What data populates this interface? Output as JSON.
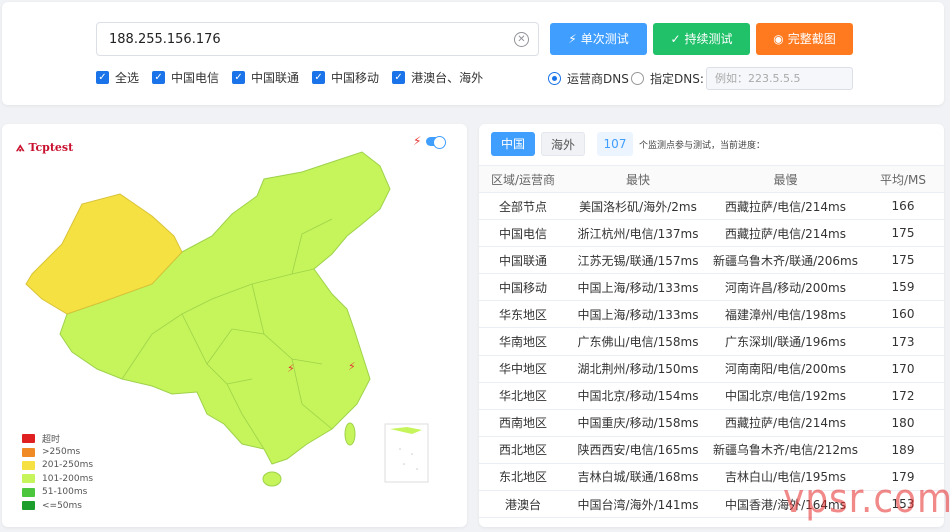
{
  "search": {
    "ip_value": "188.255.156.176",
    "clear_icon": "close-circle-icon"
  },
  "buttons": {
    "single": {
      "icon": "⚡",
      "label": "单次测试",
      "color": "#409eff"
    },
    "continuous": {
      "icon": "✓",
      "label": "持续测试",
      "color": "#21c16a"
    },
    "screenshot": {
      "icon": "◉",
      "label": "完整截图",
      "color": "#ff7a1f"
    }
  },
  "filters": [
    {
      "label": "全选",
      "checked": true
    },
    {
      "label": "中国电信",
      "checked": true
    },
    {
      "label": "中国联通",
      "checked": true
    },
    {
      "label": "中国移动",
      "checked": true
    },
    {
      "label": "港澳台、海外",
      "checked": true
    }
  ],
  "dns": {
    "option_isp": "运营商DNS",
    "option_custom": "指定DNS:",
    "selected": "isp",
    "placeholder": "例如：223.5.5.5"
  },
  "map": {
    "logo_text": "Tcptest",
    "legend": [
      {
        "label": "超时",
        "color": "#e02020"
      },
      {
        "label": ">250ms",
        "color": "#f08a24"
      },
      {
        "label": "201-250ms",
        "color": "#f5e142"
      },
      {
        "label": "101-200ms",
        "color": "#c5f55a"
      },
      {
        "label": "51-100ms",
        "color": "#4cc63c"
      },
      {
        "label": "<=50ms",
        "color": "#1c9e2c"
      }
    ]
  },
  "results": {
    "tabs": [
      "中国",
      "海外"
    ],
    "active_tab": "中国",
    "node_count": "107",
    "node_note": "个监测点参与测试，当前进度：",
    "headers": [
      "区域/运营商",
      "最快",
      "最慢",
      "平均/MS"
    ],
    "rows": [
      [
        "全部节点",
        "美国洛杉矶/海外/2ms",
        "西藏拉萨/电信/214ms",
        "166"
      ],
      [
        "中国电信",
        "浙江杭州/电信/137ms",
        "西藏拉萨/电信/214ms",
        "175"
      ],
      [
        "中国联通",
        "江苏无锡/联通/157ms",
        "新疆乌鲁木齐/联通/206ms",
        "175"
      ],
      [
        "中国移动",
        "中国上海/移动/133ms",
        "河南许昌/移动/200ms",
        "159"
      ],
      [
        "华东地区",
        "中国上海/移动/133ms",
        "福建漳州/电信/198ms",
        "160"
      ],
      [
        "华南地区",
        "广东佛山/电信/158ms",
        "广东深圳/联通/196ms",
        "173"
      ],
      [
        "华中地区",
        "湖北荆州/移动/150ms",
        "河南南阳/电信/200ms",
        "170"
      ],
      [
        "华北地区",
        "中国北京/移动/154ms",
        "中国北京/电信/192ms",
        "172"
      ],
      [
        "西南地区",
        "中国重庆/移动/158ms",
        "西藏拉萨/电信/214ms",
        "180"
      ],
      [
        "西北地区",
        "陕西西安/电信/165ms",
        "新疆乌鲁木齐/电信/212ms",
        "189"
      ],
      [
        "东北地区",
        "吉林白城/联通/168ms",
        "吉林白山/电信/195ms",
        "179"
      ],
      [
        "港澳台",
        "中国台湾/海外/141ms",
        "中国香港/海外/164ms",
        "153"
      ]
    ]
  },
  "watermark": "vpsr.com"
}
